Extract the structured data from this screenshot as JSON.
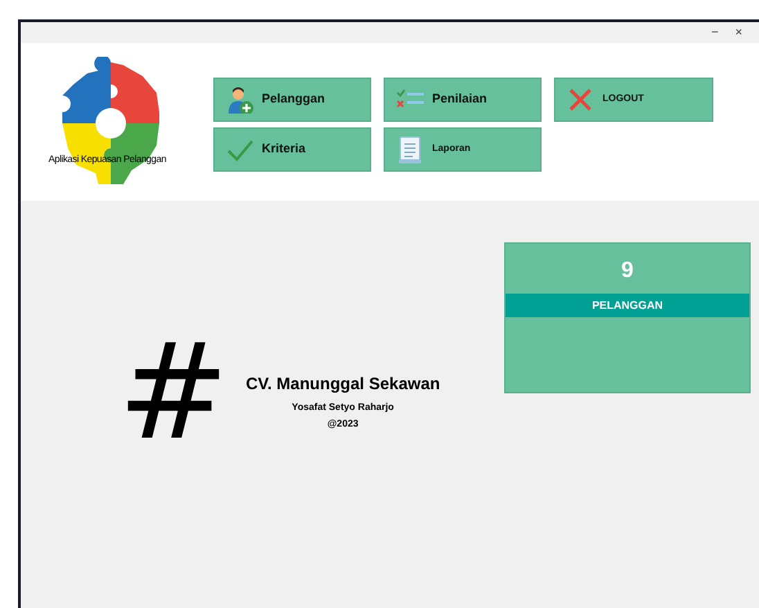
{
  "window": {
    "controls": [
      "−",
      "×"
    ]
  },
  "logo": {
    "caption": "Aplikasi Kepuasan Pelanggan"
  },
  "menu_buttons": [
    {
      "label": "Pelanggan",
      "kind": "customers"
    },
    {
      "label": "Penilaian",
      "kind": "assessment"
    },
    {
      "label": "LOGOUT",
      "kind": "logout"
    },
    {
      "label": "Kriteria",
      "kind": "criteria"
    },
    {
      "label": "Laporan",
      "kind": "report"
    }
  ],
  "about": {
    "symbol": "#",
    "company": "CV. Manunggal Sekawan",
    "author": "Yosafat Setyo Raharjo",
    "copyright": "@2023"
  },
  "stat_card": {
    "value": "9",
    "label": "PELANGGAN"
  }
}
